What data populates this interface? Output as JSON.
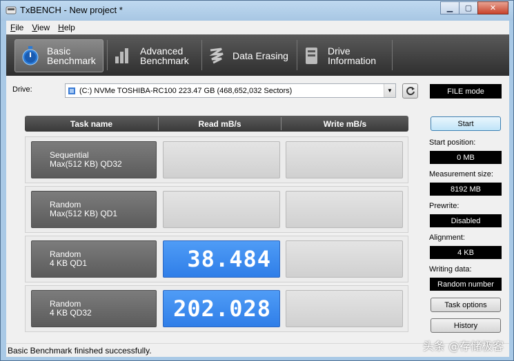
{
  "window": {
    "title": "TxBENCH - New project *",
    "minimize": "▁",
    "maximize": "▢",
    "close": "✕"
  },
  "menu": [
    {
      "label": "File",
      "accel": "F",
      "rest": "ile"
    },
    {
      "label": "View",
      "accel": "V",
      "rest": "iew"
    },
    {
      "label": "Help",
      "accel": "H",
      "rest": "elp"
    }
  ],
  "toolbar": [
    {
      "line1": "Basic",
      "line2": "Benchmark",
      "icon": "stopwatch-icon",
      "active": true
    },
    {
      "line1": "Advanced",
      "line2": "Benchmark",
      "icon": "bar-chart-icon",
      "active": false
    },
    {
      "line1": "Data Erasing",
      "line2": "",
      "icon": "eraser-icon",
      "active": false
    },
    {
      "line1": "Drive",
      "line2": "Information",
      "icon": "drive-info-icon",
      "active": false
    }
  ],
  "drive": {
    "label": "Drive:",
    "value": "(C:) NVMe TOSHIBA-RC100  223.47 GB (468,652,032 Sectors)"
  },
  "mode": "FILE mode",
  "bench": {
    "headers": {
      "task": "Task name",
      "read": "Read mB/s",
      "write": "Write mB/s"
    },
    "rows": [
      {
        "line1": "Sequential",
        "line2": "Max(512 KB) QD32",
        "read": "",
        "write": ""
      },
      {
        "line1": "Random",
        "line2": "Max(512 KB) QD1",
        "read": "",
        "write": ""
      },
      {
        "line1": "Random",
        "line2": "4 KB QD1",
        "read": "38.484",
        "write": ""
      },
      {
        "line1": "Random",
        "line2": "4 KB QD32",
        "read": "202.028",
        "write": ""
      }
    ]
  },
  "side": {
    "start": "Start",
    "start_position_label": "Start position:",
    "start_position_value": "0 MB",
    "measurement_size_label": "Measurement size:",
    "measurement_size_value": "8192 MB",
    "prewrite_label": "Prewrite:",
    "prewrite_value": "Disabled",
    "alignment_label": "Alignment:",
    "alignment_value": "4 KB",
    "writing_data_label": "Writing data:",
    "writing_data_value": "Random number",
    "task_options": "Task options",
    "history": "History"
  },
  "status": "Basic Benchmark finished successfully.",
  "watermark": "头条 @存储极客",
  "colors": {
    "accent": "#2f7ee8",
    "toolbar": "#3a3a3a"
  }
}
